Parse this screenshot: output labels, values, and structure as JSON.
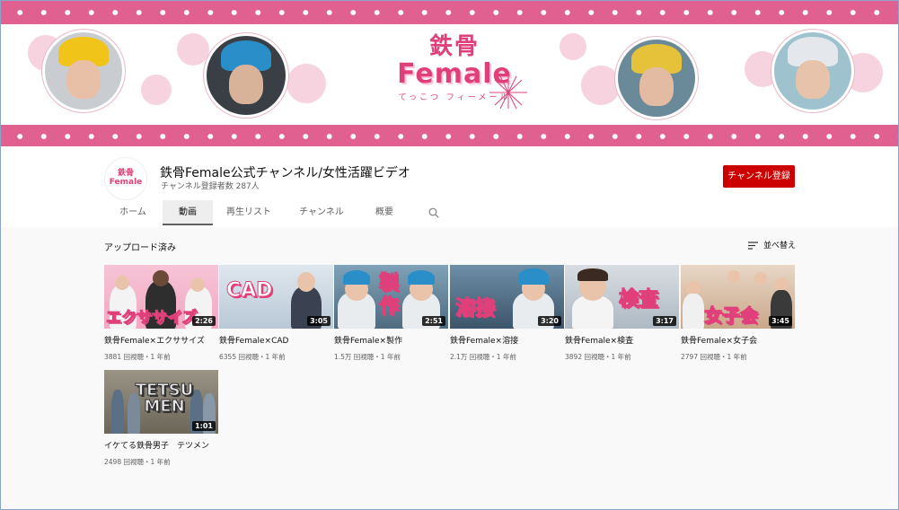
{
  "banner": {
    "logo_kanji": "鉄骨",
    "logo_latin": "Female",
    "logo_kana": "てっこつ フィーメール"
  },
  "channel": {
    "name": "鉄骨Female公式チャンネル/女性活躍ビデオ",
    "subscribers": "チャンネル登録者数 287人",
    "avatar_line1": "鉄骨",
    "avatar_line2": "Female",
    "subscribe_label": "チャンネル登録"
  },
  "tabs": [
    {
      "label": "ホーム",
      "active": false
    },
    {
      "label": "動画",
      "active": true
    },
    {
      "label": "再生リスト",
      "active": false
    },
    {
      "label": "チャンネル",
      "active": false
    },
    {
      "label": "概要",
      "active": false
    }
  ],
  "section": {
    "title": "アップロード済み",
    "sort_label": "並べ替え"
  },
  "videos": [
    {
      "title": "鉄骨Female×エクササイズ",
      "meta": "3881 回視聴・1 年前",
      "duration": "2:26",
      "thumb_text": "エクササイズ"
    },
    {
      "title": "鉄骨Female×CAD",
      "meta": "6355 回視聴・1 年前",
      "duration": "3:05",
      "thumb_text": "CAD"
    },
    {
      "title": "鉄骨Female×製作",
      "meta": "1.5万 回視聴・1 年前",
      "duration": "2:51",
      "thumb_text": "製作"
    },
    {
      "title": "鉄骨Female×溶接",
      "meta": "2.1万 回視聴・1 年前",
      "duration": "3:20",
      "thumb_text": "溶接"
    },
    {
      "title": "鉄骨Female×検査",
      "meta": "3892 回視聴・1 年前",
      "duration": "3:17",
      "thumb_text": "検査"
    },
    {
      "title": "鉄骨Female×女子会",
      "meta": "2797 回視聴・1 年前",
      "duration": "3:45",
      "thumb_text": "女子会"
    },
    {
      "title": "イケてる鉄骨男子　テツメン",
      "meta": "2498 回視聴・1 年前",
      "duration": "1:01",
      "thumb_text": "TETSU MEN"
    }
  ],
  "colors": {
    "brand_pink": "#e0608f",
    "subscribe_red": "#cc0000"
  }
}
